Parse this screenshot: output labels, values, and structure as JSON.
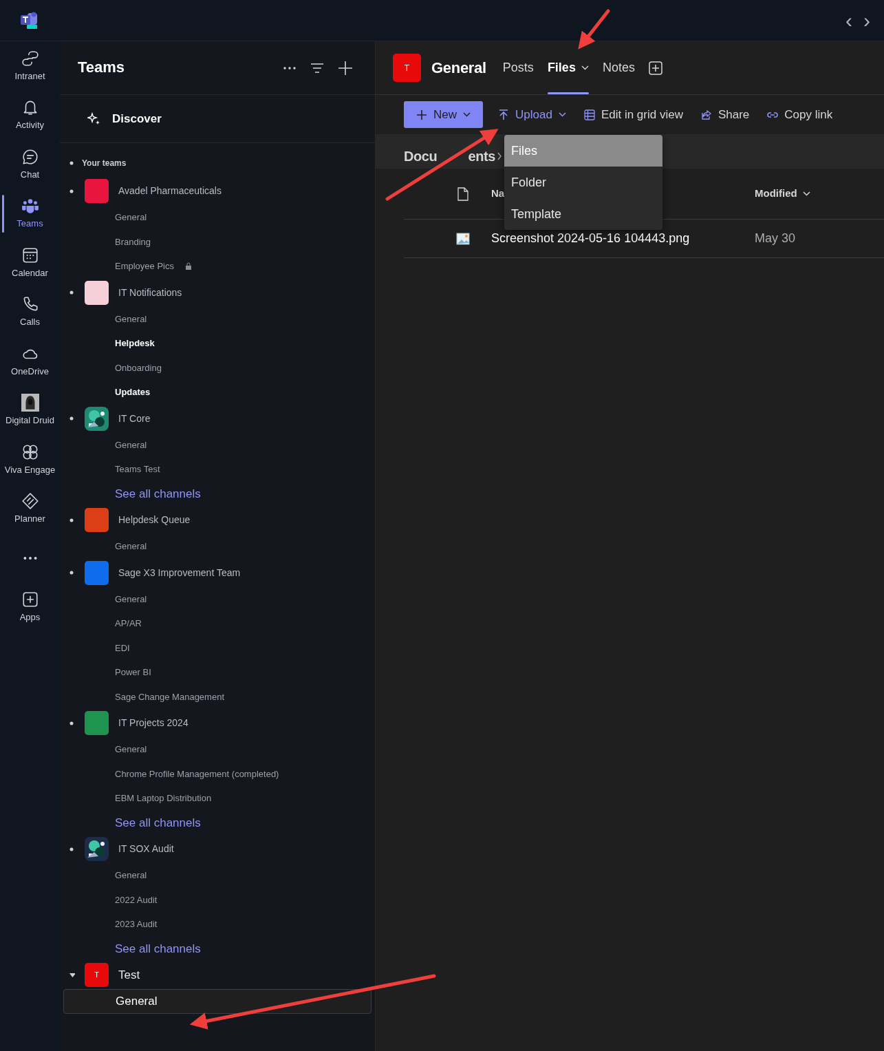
{
  "top_bar": {
    "back": "‹",
    "forward": "›"
  },
  "rail": [
    {
      "label": "Intranet",
      "selected": false
    },
    {
      "label": "Activity",
      "selected": false
    },
    {
      "label": "Chat",
      "selected": false
    },
    {
      "label": "Teams",
      "selected": true
    },
    {
      "label": "Calendar",
      "selected": false
    },
    {
      "label": "Calls",
      "selected": false
    },
    {
      "label": "OneDrive",
      "selected": false
    },
    {
      "label": "Digital Druid",
      "selected": false
    },
    {
      "label": "Viva Engage",
      "selected": false
    },
    {
      "label": "Planner",
      "selected": false
    },
    {
      "selected": false
    },
    {
      "label": "Apps",
      "selected": false
    }
  ],
  "teams_panel": {
    "title": "Teams",
    "discover": "Discover",
    "section": "Your teams",
    "teams": [
      {
        "name": "Avadel Pharmaceuticals",
        "expanded": false,
        "avatar": {
          "kind": "initials",
          "color": "#e8163e"
        },
        "channels": [
          {
            "name": "General",
            "unread": false,
            "selected": false,
            "kind": "channel"
          },
          {
            "name": "Branding",
            "unread": false,
            "selected": false,
            "kind": "channel"
          },
          {
            "name": "Employee Pics",
            "unread": false,
            "selected": false,
            "kind": "private"
          }
        ]
      },
      {
        "name": "IT Notifications",
        "expanded": false,
        "avatar": {
          "kind": "initials",
          "color": "#f6d0d8"
        },
        "channels": [
          {
            "name": "General",
            "unread": false,
            "selected": false,
            "kind": "channel"
          },
          {
            "name": "Helpdesk",
            "unread": true,
            "selected": false,
            "kind": "channel"
          },
          {
            "name": "Onboarding",
            "unread": false,
            "selected": false,
            "kind": "channel"
          },
          {
            "name": "Updates",
            "unread": true,
            "selected": false,
            "kind": "channel"
          }
        ]
      },
      {
        "name": "IT Core",
        "expanded": false,
        "avatar": {
          "kind": "picture",
          "color": "#1e8a72"
        },
        "channels": [
          {
            "name": "General",
            "unread": false,
            "selected": false,
            "kind": "channel"
          },
          {
            "name": "Teams Test",
            "unread": false,
            "selected": false,
            "kind": "channel"
          },
          {
            "name": "See all channels",
            "unread": false,
            "selected": false,
            "kind": "link"
          }
        ]
      },
      {
        "name": "Helpdesk Queue",
        "expanded": false,
        "avatar": {
          "kind": "initials",
          "color": "#dc3e15"
        },
        "channels": [
          {
            "name": "General",
            "unread": false,
            "selected": false,
            "kind": "channel"
          }
        ]
      },
      {
        "name": "Sage X3 Improvement Team",
        "expanded": false,
        "avatar": {
          "kind": "initials",
          "color": "#0f6cec"
        },
        "channels": [
          {
            "name": "General",
            "unread": false,
            "selected": false,
            "kind": "channel"
          },
          {
            "name": "AP/AR",
            "unread": false,
            "selected": false,
            "kind": "channel"
          },
          {
            "name": "EDI",
            "unread": false,
            "selected": false,
            "kind": "channel"
          },
          {
            "name": "Power BI",
            "unread": false,
            "selected": false,
            "kind": "channel"
          },
          {
            "name": "Sage Change Management",
            "unread": false,
            "selected": false,
            "kind": "channel"
          }
        ]
      },
      {
        "name": "IT Projects 2024",
        "expanded": false,
        "avatar": {
          "kind": "initials",
          "color": "#1f9450"
        },
        "channels": [
          {
            "name": "General",
            "unread": false,
            "selected": false,
            "kind": "channel"
          },
          {
            "name": "Chrome Profile Management (completed)",
            "unread": false,
            "selected": false,
            "kind": "channel"
          },
          {
            "name": "EBM Laptop Distribution",
            "unread": false,
            "selected": false,
            "kind": "channel"
          },
          {
            "name": "See all channels",
            "unread": false,
            "selected": false,
            "kind": "link"
          }
        ]
      },
      {
        "name": "IT SOX Audit",
        "expanded": false,
        "avatar": {
          "kind": "picture",
          "color": "#1c2d4a"
        },
        "channels": [
          {
            "name": "General",
            "unread": false,
            "selected": false,
            "kind": "channel"
          },
          {
            "name": "2022 Audit",
            "unread": false,
            "selected": false,
            "kind": "channel"
          },
          {
            "name": "2023 Audit",
            "unread": false,
            "selected": false,
            "kind": "channel"
          },
          {
            "name": "See all channels",
            "unread": false,
            "selected": false,
            "kind": "link"
          }
        ]
      },
      {
        "name": "Test",
        "expanded": true,
        "avatar": {
          "kind": "initials",
          "color": "#e80a0a",
          "letter": "T"
        },
        "channels": [
          {
            "name": "General",
            "unread": false,
            "selected": true,
            "kind": "channel"
          }
        ]
      }
    ]
  },
  "channel_header": {
    "avatar": "T",
    "title": "General",
    "tabs": [
      {
        "label": "Posts",
        "selected": false,
        "has_menu": false
      },
      {
        "label": "Files",
        "selected": true,
        "has_menu": true
      },
      {
        "label": "Notes",
        "selected": false,
        "has_menu": false
      }
    ]
  },
  "toolbar": [
    {
      "label": "New",
      "kind": "primary",
      "open": false
    },
    {
      "label": "Upload",
      "kind": "menu",
      "open": true
    },
    {
      "label": "Edit in grid view",
      "kind": "plain",
      "open": false
    },
    {
      "label": "Share",
      "kind": "plain",
      "open": false
    },
    {
      "label": "Copy link",
      "kind": "plain",
      "open": false
    }
  ],
  "upload_menu": [
    {
      "label": "Files",
      "selected": true
    },
    {
      "label": "Folder",
      "selected": false
    },
    {
      "label": "Template",
      "selected": false
    }
  ],
  "breadcrumb": [
    "Docu",
    "ents"
  ],
  "table": {
    "columns": [
      {
        "label": "Na",
        "sortable": false
      },
      {
        "label": "Modified",
        "sortable": true
      }
    ],
    "rows": [
      {
        "name": "Screenshot 2024-05-16 104443.png",
        "modified": "May 30"
      }
    ]
  }
}
